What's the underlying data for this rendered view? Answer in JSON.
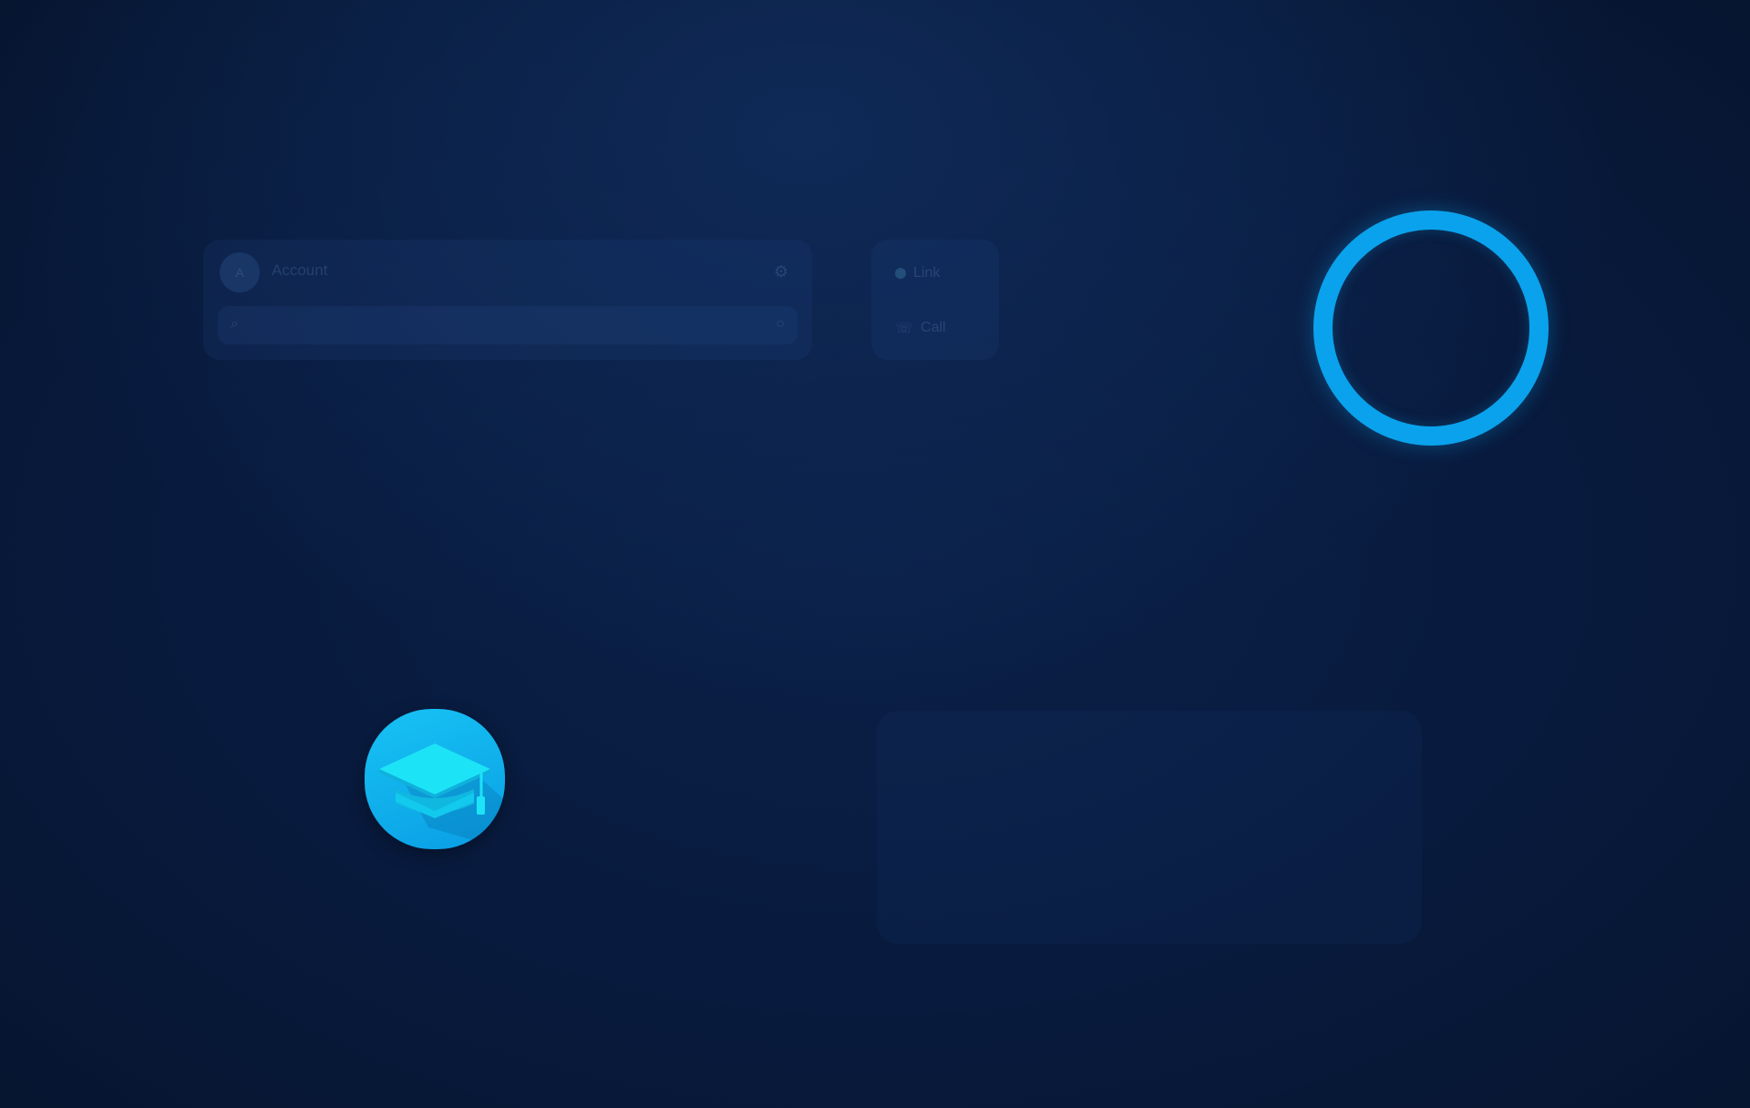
{
  "account": {
    "name": "Account",
    "avatar_initial": "A"
  },
  "actions": [
    {
      "label": "Link"
    },
    {
      "label": "Call"
    }
  ],
  "colors": {
    "accent": "#0aa2ec",
    "tile": "#17c3f4",
    "cap": "#19e3f5",
    "background": "#081a3d"
  },
  "icons": {
    "tile_icon": "graduation-cap-icon",
    "ring": "ring-icon"
  }
}
